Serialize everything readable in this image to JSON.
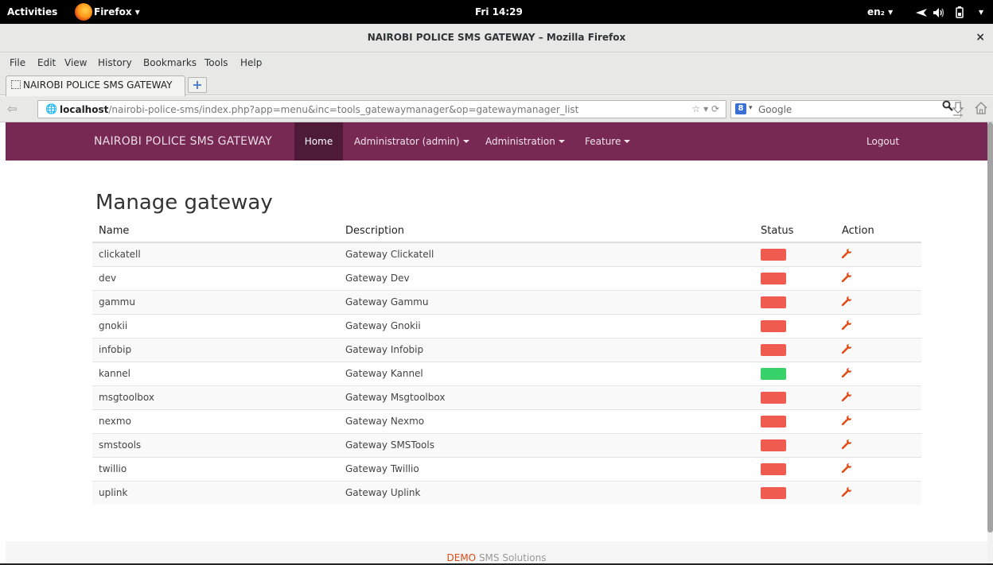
{
  "system_bar": {
    "activities": "Activities",
    "app_menu": "Firefox ▾",
    "clock": "Fri 14:29",
    "input_source": "en₂ ▾",
    "tray_icons": [
      "airplane-icon",
      "volume-icon",
      "battery-icon",
      "system-menu-icon"
    ]
  },
  "window": {
    "title": "NAIROBI POLICE SMS GATEWAY – Mozilla Firefox",
    "close": "×"
  },
  "menubar": {
    "items": [
      {
        "label": "File",
        "access_key": "F"
      },
      {
        "label": "Edit",
        "access_key": "E"
      },
      {
        "label": "View",
        "access_key": "V"
      },
      {
        "label": "History",
        "access_key": "s"
      },
      {
        "label": "Bookmarks",
        "access_key": "B"
      },
      {
        "label": "Tools",
        "access_key": "T"
      },
      {
        "label": "Help",
        "access_key": "H"
      }
    ]
  },
  "tabs": [
    {
      "label": "NAIROBI POLICE SMS GATEWAY",
      "active": true
    }
  ],
  "new_tab_label": "+",
  "navbar": {
    "url_host": "localhost",
    "url_path": "/nairobi-police-sms/index.php?app=menu&inc=tools_gatewaymanager&op=gatewaymanager_list",
    "url_controls": "☆ ▾ ⟳",
    "search_engine_letter": "8",
    "search_engine_arrow": "▾",
    "search_placeholder": "Google"
  },
  "app": {
    "brand": "NAIROBI POLICE SMS GATEWAY",
    "nav": {
      "home": "Home",
      "admin_user": "Administrator (admin)",
      "administration": "Administration",
      "feature": "Feature",
      "logout": "Logout"
    },
    "page_title": "Manage gateway",
    "table": {
      "headers": {
        "name": "Name",
        "description": "Description",
        "status": "Status",
        "action": "Action"
      },
      "rows": [
        {
          "name": "clickatell",
          "description": "Gateway Clickatell",
          "status": "inactive"
        },
        {
          "name": "dev",
          "description": "Gateway Dev",
          "status": "inactive"
        },
        {
          "name": "gammu",
          "description": "Gateway Gammu",
          "status": "inactive"
        },
        {
          "name": "gnokii",
          "description": "Gateway Gnokii",
          "status": "inactive"
        },
        {
          "name": "infobip",
          "description": "Gateway Infobip",
          "status": "inactive"
        },
        {
          "name": "kannel",
          "description": "Gateway Kannel",
          "status": "active"
        },
        {
          "name": "msgtoolbox",
          "description": "Gateway Msgtoolbox",
          "status": "inactive"
        },
        {
          "name": "nexmo",
          "description": "Gateway Nexmo",
          "status": "inactive"
        },
        {
          "name": "smstools",
          "description": "Gateway SMSTools",
          "status": "inactive"
        },
        {
          "name": "twillio",
          "description": "Gateway Twillio",
          "status": "inactive"
        },
        {
          "name": "uplink",
          "description": "Gateway Uplink",
          "status": "inactive"
        }
      ],
      "action_icon": "wrench-icon"
    },
    "footer": {
      "demo": "DEMO",
      "rest": " SMS Solutions"
    }
  },
  "colors": {
    "navbar_bg": "#772953",
    "nav_active_bg": "#4d1a37",
    "status_inactive": "#f05b4f",
    "status_active": "#38d26a",
    "wrench": "#df4a16"
  }
}
